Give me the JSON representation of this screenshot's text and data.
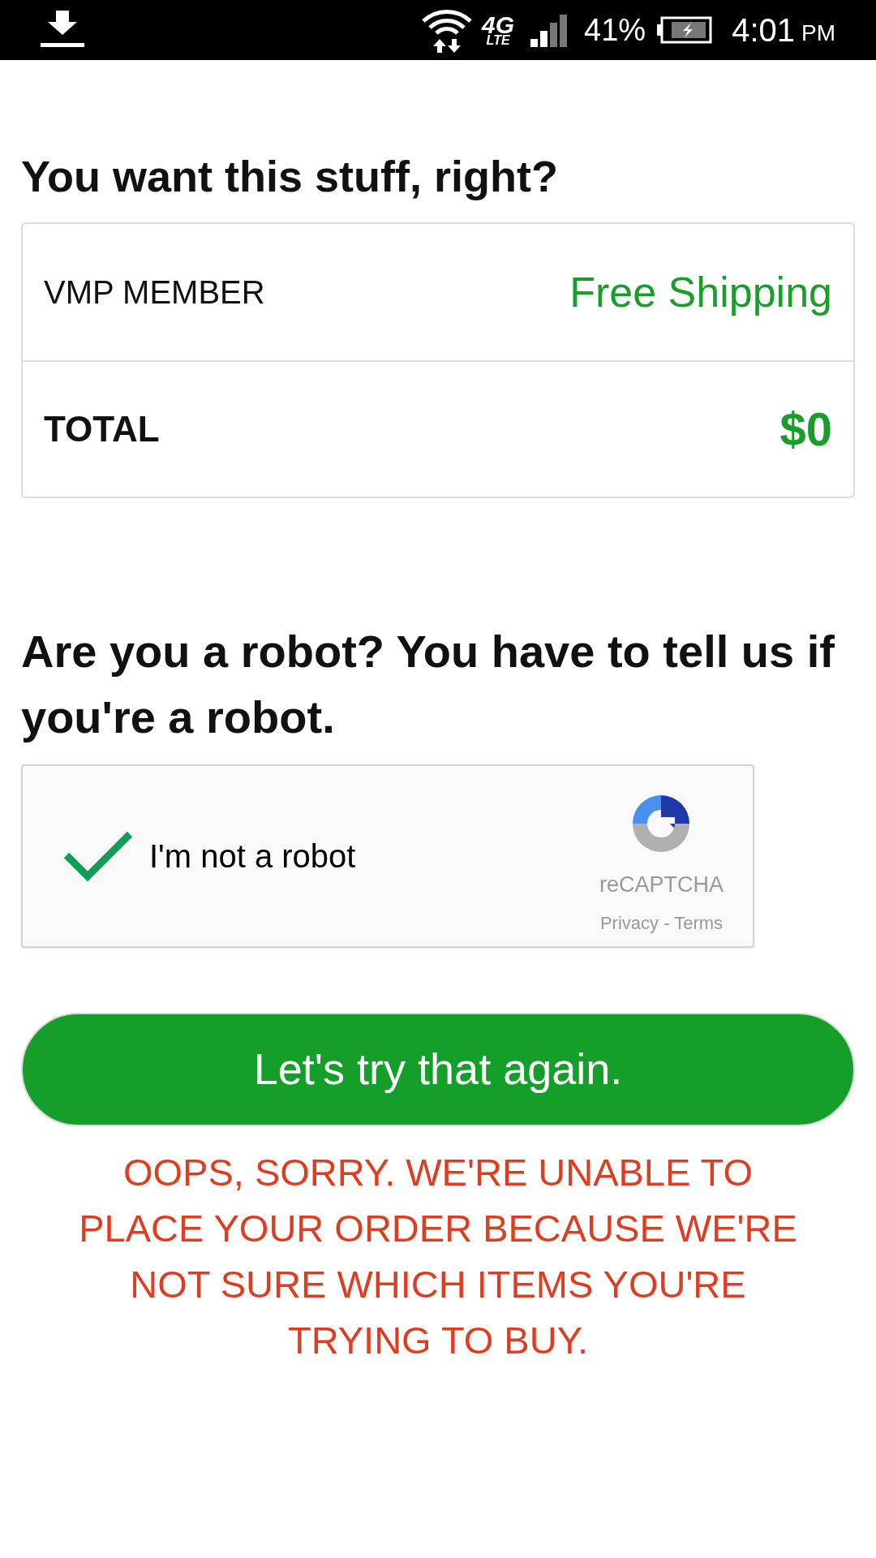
{
  "status_bar": {
    "battery": "41%",
    "time": "4:01",
    "meridiem": "PM",
    "charging": true,
    "network": "4G",
    "network_sub": "LTE"
  },
  "order": {
    "title": "You want this stuff, right?",
    "rows": [
      {
        "label": "VMP MEMBER",
        "value": "Free Shipping",
        "kind": "plain"
      },
      {
        "label": "TOTAL",
        "value": "$0",
        "kind": "total"
      }
    ]
  },
  "robot": {
    "title": "Are you a robot? You have to tell us if you're a robot.",
    "captcha": {
      "label": "I'm not a robot",
      "checked": true,
      "brand": "reCAPTCHA",
      "links": "Privacy - Terms"
    }
  },
  "submit_button": "Let's try that again.",
  "error_lines": [
    "OOPS, SORRY. WE'RE UNABLE TO",
    "PLACE YOUR ORDER BECAUSE WE'RE",
    "NOT SURE WHICH ITEMS YOU'RE",
    "TRYING TO BUY."
  ]
}
